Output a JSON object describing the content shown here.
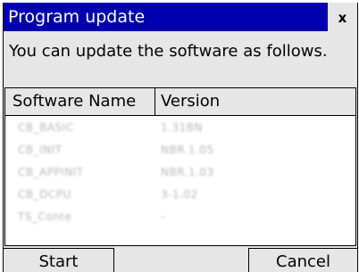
{
  "dialog": {
    "title": "Program update",
    "close_label": "x",
    "instructions": "You can update the software as follows."
  },
  "table": {
    "columns": [
      "Software Name",
      "Version"
    ],
    "rows": [
      {
        "name": "CB_BASIC",
        "version": "1.31BN"
      },
      {
        "name": "CB_INIT",
        "version": "NBR.1.05"
      },
      {
        "name": "CB_APPINIT",
        "version": "NBR.1.03"
      },
      {
        "name": "CB_DCPU",
        "version": "3-1.02"
      },
      {
        "name": "TS_Conte",
        "version": "-"
      }
    ]
  },
  "buttons": {
    "start": "Start",
    "cancel": "Cancel"
  }
}
